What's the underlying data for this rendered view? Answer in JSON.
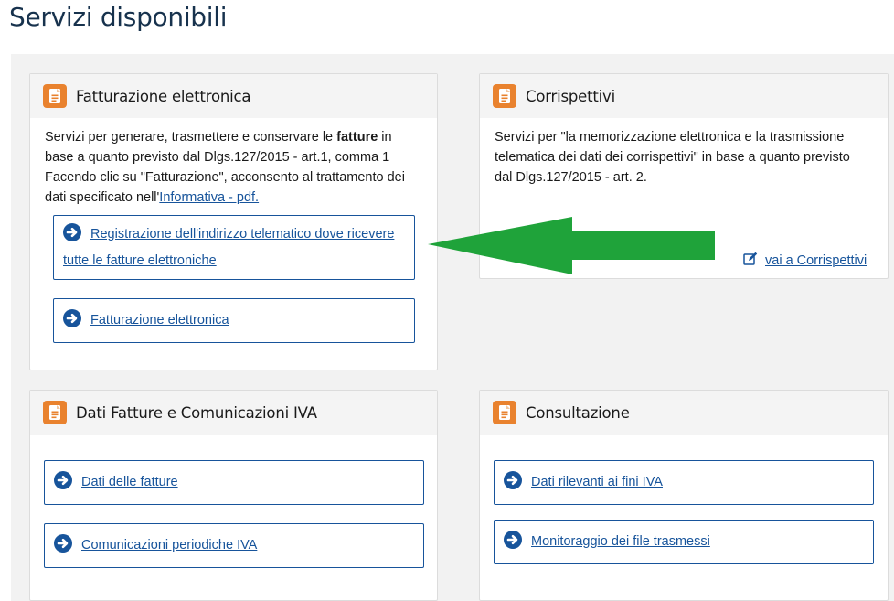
{
  "page": {
    "title": "Servizi disponibili"
  },
  "colors": {
    "accent": "#17549b",
    "icon_orange": "#e9822e",
    "annotation_arrow": "#1fa33a",
    "panel_bg": "#f2f2f2"
  },
  "cards": {
    "fatturazione": {
      "title": "Fatturazione elettronica",
      "icon": "document-icon",
      "desc_before": "Servizi per generare, trasmettere e conservare le ",
      "desc_bold": "fatture",
      "desc_mid": " in base a quanto previsto dal Dlgs.127/2015 - art.1, comma 1 Facendo clic su \"Fatturazione\", acconsento al trattamento dei dati specificato nell'",
      "desc_link": "Informativa - pdf.",
      "buttons": [
        {
          "label": "Registrazione dell'indirizzo telematico dove ricevere tutte le fatture elettroniche",
          "icon": "arrow-right-circle-icon"
        },
        {
          "label": "Fatturazione elettronica",
          "icon": "arrow-right-circle-icon"
        }
      ]
    },
    "corrispettivi": {
      "title": "Corrispettivi",
      "icon": "document-icon",
      "desc": "Servizi per \"la memorizzazione elettronica e la trasmissione telematica dei dati dei corrispettivi\" in base a quanto previsto dal Dlgs.127/2015 - art. 2.",
      "link": {
        "label": "vai a Corrispettivi",
        "icon": "edit-icon"
      }
    },
    "dati_fatture": {
      "title": "Dati Fatture e Comunicazioni IVA",
      "icon": "document-icon",
      "buttons": [
        {
          "label": "Dati delle fatture",
          "icon": "arrow-right-circle-icon"
        },
        {
          "label": "Comunicazioni periodiche IVA",
          "icon": "arrow-right-circle-icon"
        }
      ]
    },
    "consultazione": {
      "title": "Consultazione",
      "icon": "document-icon",
      "buttons": [
        {
          "label": "Dati rilevanti ai fini IVA",
          "icon": "arrow-right-circle-icon"
        },
        {
          "label": "Monitoraggio dei file trasmessi",
          "icon": "arrow-right-circle-icon"
        }
      ]
    }
  },
  "annotation": {
    "icon": "green-arrow-left-icon"
  }
}
